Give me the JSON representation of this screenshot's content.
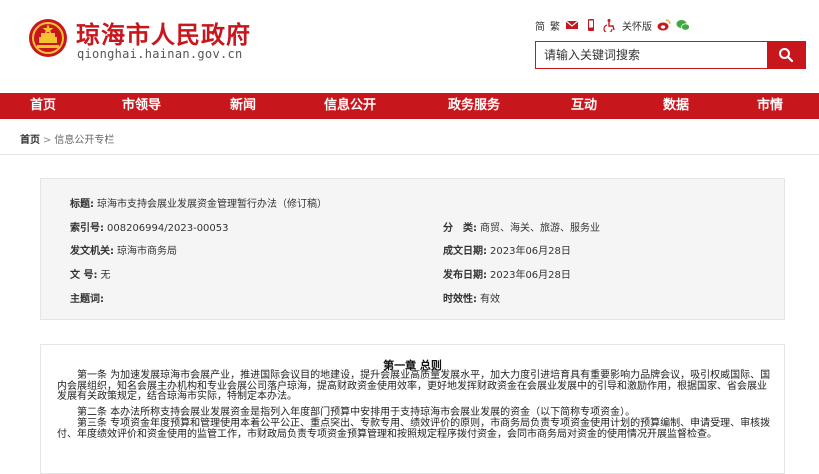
{
  "header": {
    "site_title": "琼海市人民政府",
    "site_url": "qionghai.hainan.gov.cn",
    "logo_icon": "national-emblem-icon",
    "tools": {
      "simplified": "简",
      "traditional": "繁",
      "care_mode": "关怀版"
    },
    "search": {
      "placeholder": "请输入关键词搜索"
    },
    "brand_color": "#c8161d"
  },
  "nav": {
    "items": [
      "首页",
      "市领导",
      "新闻",
      "信息公开",
      "政务服务",
      "互动",
      "数据",
      "市情"
    ]
  },
  "breadcrumb": {
    "home": "首页",
    "separator": ">",
    "current": "信息公开专栏"
  },
  "meta": {
    "title_label": "标题:",
    "title_value": "琼海市支持会展业发展资金管理暂行办法（修订稿）",
    "index_label": "索引号:",
    "index_value": "008206994/2023-00053",
    "category_label": "分　类:",
    "category_value": "商贸、海关、旅游、服务业",
    "issuer_label": "发文机关:",
    "issuer_value": "琼海市商务局",
    "created_label": "成文日期:",
    "created_value": "2023年06月28日",
    "docno_label": "文  号:",
    "docno_value": "无",
    "published_label": "发布日期:",
    "published_value": "2023年06月28日",
    "subject_label": "主题词:",
    "subject_value": "",
    "validity_label": "时效性:",
    "validity_value": "有效"
  },
  "content": {
    "chapter_title": "第一章 总则",
    "article1": "　　第一条 为加速发展琼海市会展产业，推进国际会议目的地建设，提升会展业高质量发展水平，加大力度引进培育具有重要影响力品牌会议，吸引权威国际、国内会展组织，知名会展主办机构和专业会展公司落户琼海，提高财政资金使用效率，更好地发挥财政资金在会展业发展中的引导和激励作用，根据国家、省会展业发展有关政策规定，结合琼海市实际，特制定本办法。",
    "article2": "　　第二条 本办法所称支持会展业发展资金是指列入年度部门预算中安排用于支持琼海市会展业发展的资金（以下简称专项资金）。",
    "article3": "　　第三条 专项资金年度预算和管理使用本着公平公正、重点突出、专款专用、绩效评价的原则，市商务局负责专项资金使用计划的预算编制、申请受理、审核拨付、年度绩效评价和资金使用的监管工作，市财政局负责专项资金预算管理和按照规定程序拨付资金，会同市商务局对资金的使用情况开展监督检查。"
  }
}
